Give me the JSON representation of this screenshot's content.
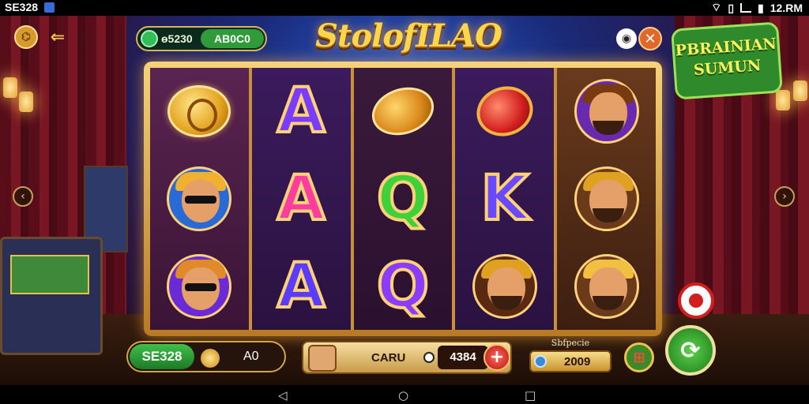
{
  "status_bar": {
    "left_text": "SE328",
    "time": "12.RM"
  },
  "header": {
    "coin_value": "ɵ5230",
    "coin_secondary": "AB0C0",
    "logo_text": "StolofILAO",
    "promo_text": "PBRAINIAN SUMUN"
  },
  "reels": [
    [
      {
        "kind": "coin",
        "name": "gold-coin-symbol"
      },
      {
        "kind": "face",
        "name": "dog-sunglasses-symbol",
        "hat": "#f0b030",
        "bg": "#2a6ad6"
      },
      {
        "kind": "face",
        "name": "fox-sunglasses-symbol",
        "hat": "#e08a2a",
        "bg": "#6a2ad6"
      }
    ],
    [
      {
        "kind": "letter",
        "text": "A",
        "color": "#7a3cff"
      },
      {
        "kind": "letter",
        "text": "A",
        "color": "#ff3ca0"
      },
      {
        "kind": "letter",
        "text": "A",
        "color": "#5a3cff"
      }
    ],
    [
      {
        "kind": "lemon",
        "name": "lemon-symbol"
      },
      {
        "kind": "letter",
        "text": "Q",
        "color": "#3fd13a"
      },
      {
        "kind": "letter",
        "text": "Q",
        "color": "#8a3cff"
      }
    ],
    [
      {
        "kind": "ruby",
        "name": "red-gem-symbol"
      },
      {
        "kind": "letter",
        "text": "K",
        "color": "#6a4aff"
      },
      {
        "kind": "face",
        "name": "bear-hood-man-symbol",
        "hat": "#e0a020",
        "bg": "#5a2a10"
      }
    ],
    [
      {
        "kind": "face",
        "name": "bearded-man-symbol",
        "hat": "#7a3a10",
        "bg": "#6a2ab0"
      },
      {
        "kind": "face",
        "name": "bandana-man-symbol",
        "hat": "#e0a020",
        "bg": "#6a3a1a"
      },
      {
        "kind": "face",
        "name": "hooded-man-symbol",
        "hat": "#f2c040",
        "bg": "#6a3a1a"
      }
    ]
  ],
  "bottom": {
    "balance_tag": "SE328",
    "balance_value": "A0",
    "bet_label": "CARU",
    "bet_amount": "4384",
    "plus_label": "+",
    "win_caption": "Sbfpecie",
    "win_value": "2009"
  },
  "nav": {
    "back": "◁",
    "home": "○",
    "recent": "□"
  },
  "colors": {
    "accent_gold": "#f0c050",
    "green": "#2f9b3b",
    "red": "#d11e1e"
  }
}
